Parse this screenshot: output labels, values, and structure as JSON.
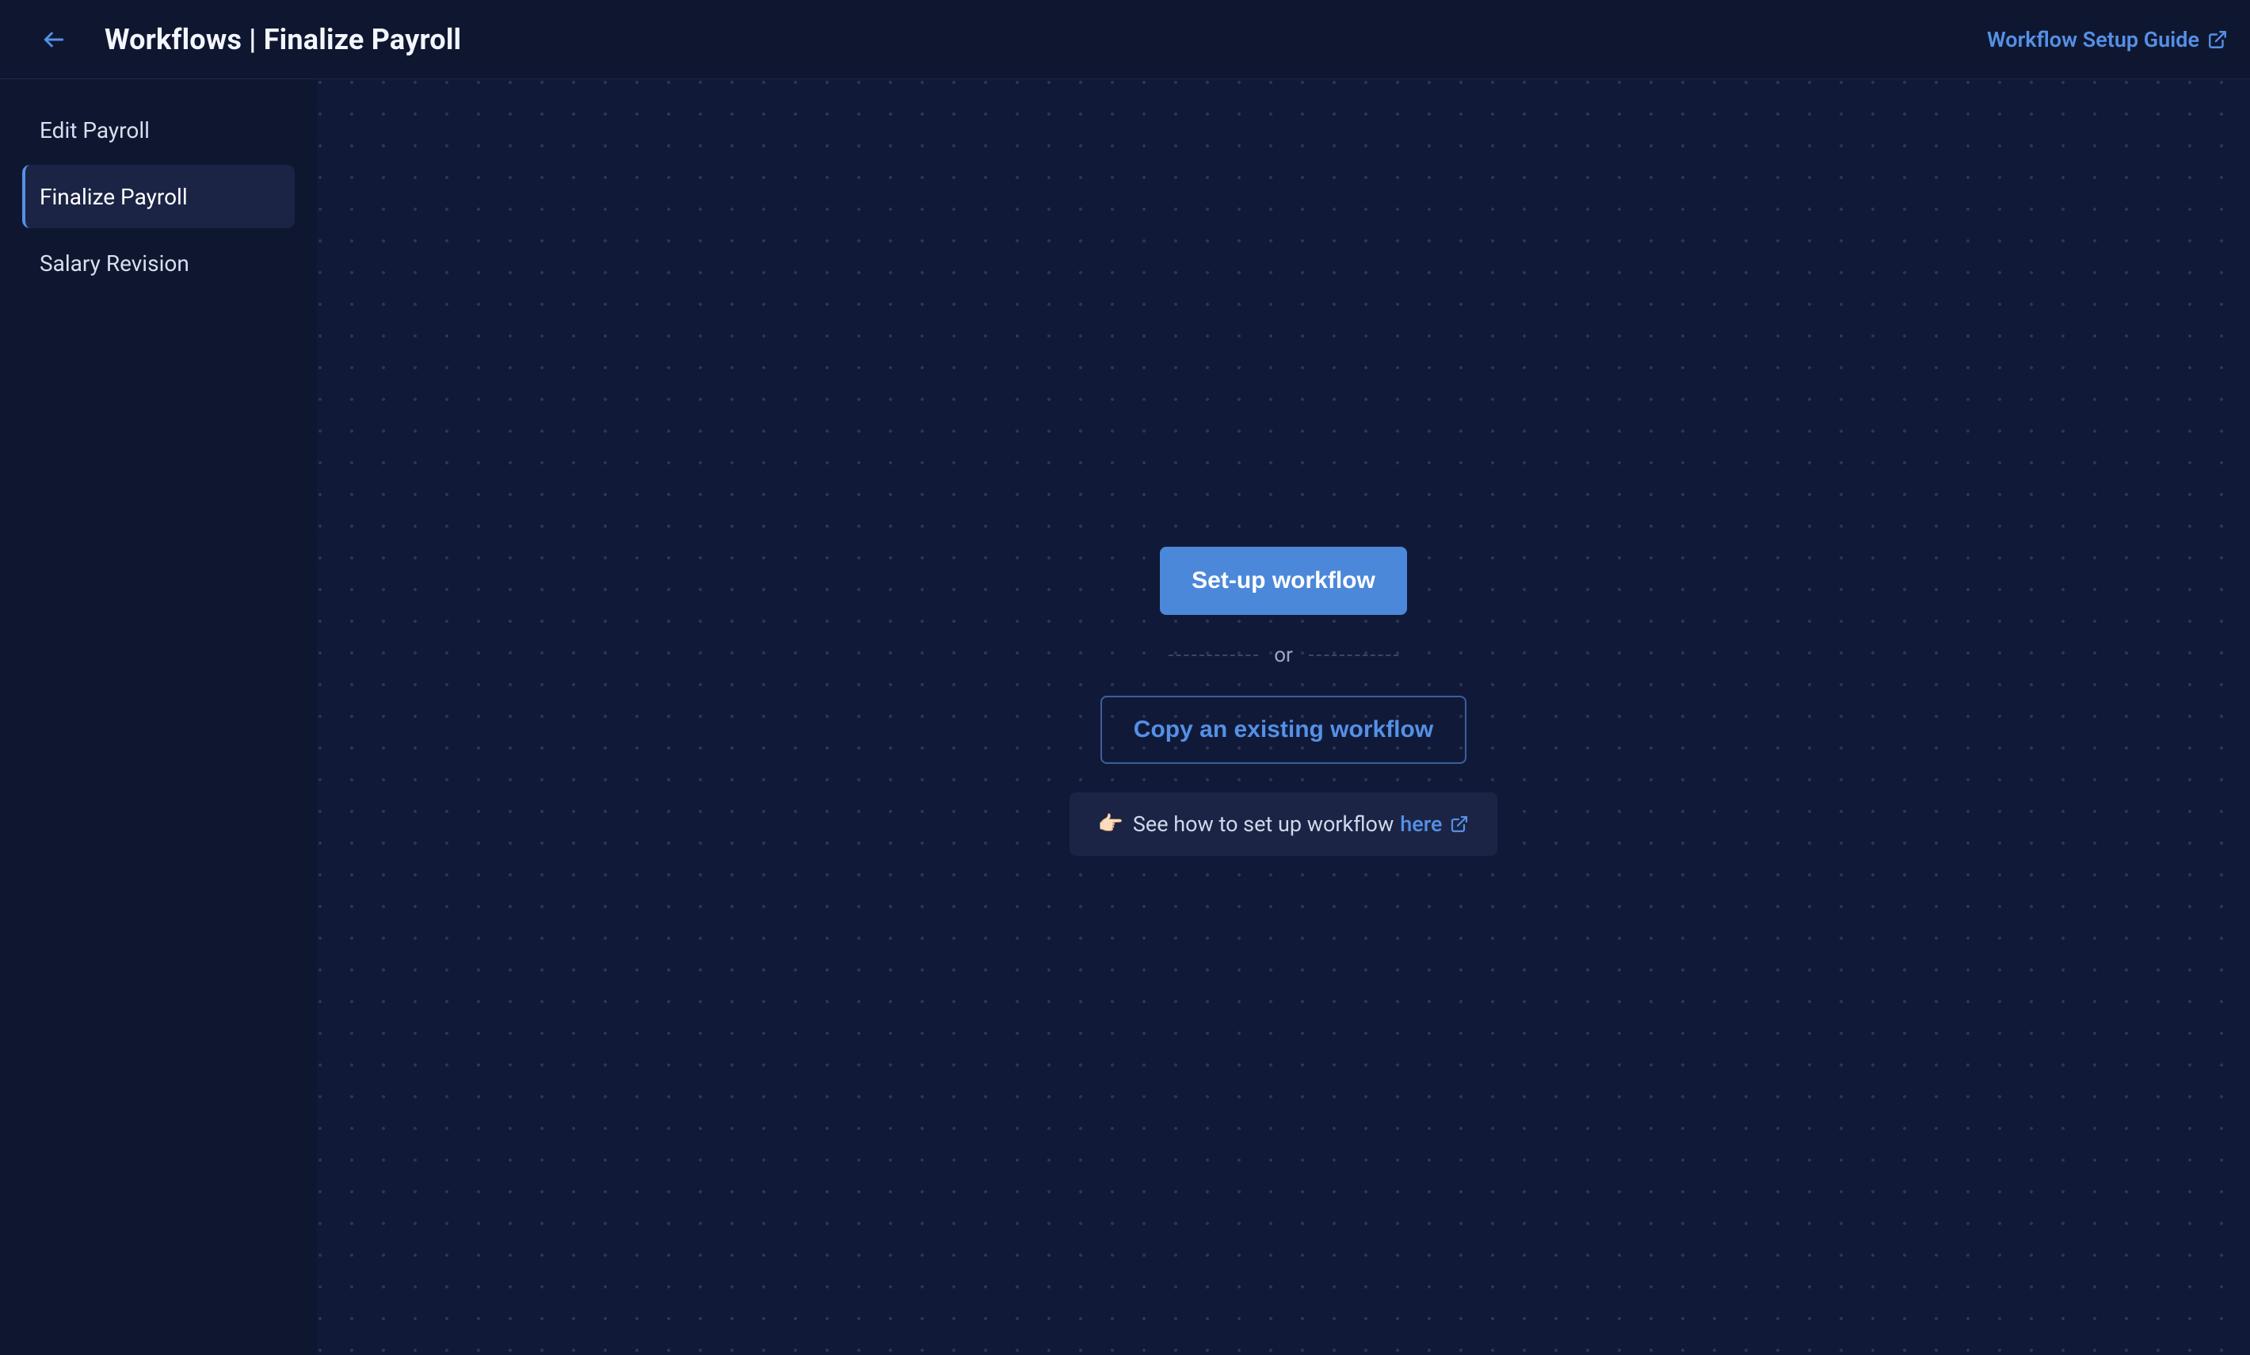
{
  "header": {
    "title": "Workflows | Finalize Payroll",
    "guide_link_label": "Workflow Setup Guide"
  },
  "sidebar": {
    "items": [
      {
        "label": "Edit Payroll",
        "active": false
      },
      {
        "label": "Finalize Payroll",
        "active": true
      },
      {
        "label": "Salary Revision",
        "active": false
      }
    ]
  },
  "main": {
    "setup_button_label": "Set-up workflow",
    "divider_text": "or",
    "copy_button_label": "Copy an existing workflow",
    "hint_emoji": "👉🏻",
    "hint_text": "See how to set up workflow ",
    "hint_link_label": "here"
  }
}
